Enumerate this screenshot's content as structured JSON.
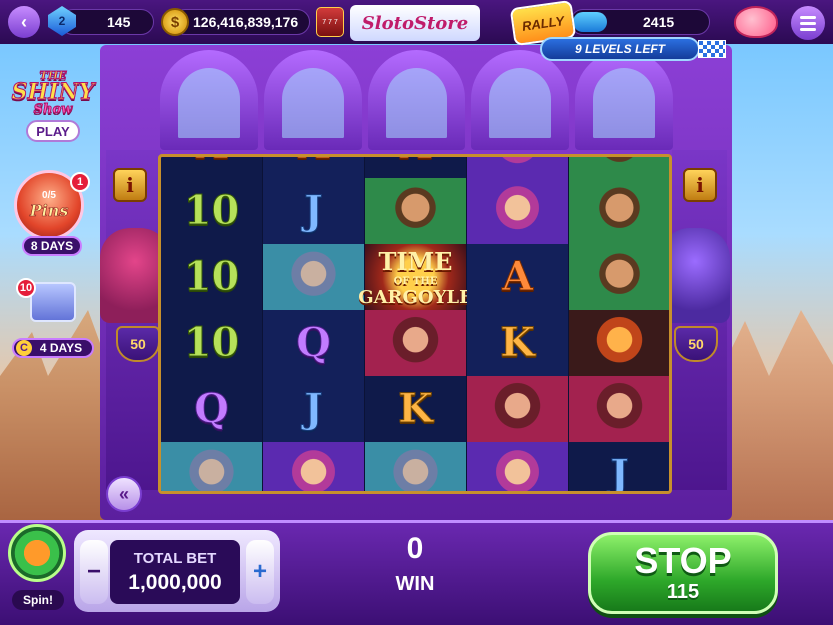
{
  "header": {
    "gems": "145",
    "coins": "126,416,839,176",
    "store_label": "SlotoStore",
    "slot_icon_text": "7 7 7",
    "rally_label": "RALLY",
    "rally_points": "2415",
    "rally_progress": 0.25,
    "levels_left": "9 LEVELS LEFT"
  },
  "side": {
    "shiny_show": {
      "line1": "THE",
      "line2": "SHINY",
      "line3": "Show"
    },
    "play_label": "PLAY",
    "pins_progress": "0/5",
    "pins_label": "Pins",
    "pins_badge": "1",
    "pins_days": "8 DAYS",
    "chest_badge": "10",
    "chest_days": "4 DAYS",
    "c_icon": "C",
    "collapse_icon": "«"
  },
  "machine": {
    "info_left": "i",
    "info_right": "i",
    "shield_left": "50",
    "shield_right": "50",
    "logo": {
      "line1": "TIME",
      "line2": "OF THE",
      "line3": "GARGOYLE"
    },
    "reels": [
      [
        {
          "type": "text",
          "v": "A",
          "c": "ace"
        },
        {
          "type": "text",
          "v": "A",
          "c": "ace"
        },
        {
          "type": "text",
          "v": "A",
          "c": "ace"
        },
        {
          "type": "face",
          "f": "jester"
        },
        {
          "type": "face",
          "f": "man"
        }
      ],
      [
        {
          "type": "text",
          "v": "10",
          "c": "ten"
        },
        {
          "type": "text",
          "v": "J",
          "c": "jack"
        },
        {
          "type": "face",
          "f": "man"
        },
        {
          "type": "face",
          "f": "jester"
        },
        {
          "type": "face",
          "f": "man"
        }
      ],
      [
        {
          "type": "text",
          "v": "10",
          "c": "ten"
        },
        {
          "type": "face",
          "f": "wizard"
        },
        {
          "type": "logo"
        },
        {
          "type": "text",
          "v": "A",
          "c": "ace"
        },
        {
          "type": "face",
          "f": "man"
        }
      ],
      [
        {
          "type": "text",
          "v": "10",
          "c": "ten"
        },
        {
          "type": "text",
          "v": "Q",
          "c": "queen"
        },
        {
          "type": "face",
          "f": "lady"
        },
        {
          "type": "text",
          "v": "K",
          "c": "king"
        },
        {
          "type": "face",
          "f": "demon"
        }
      ],
      [
        {
          "type": "text",
          "v": "Q",
          "c": "queen"
        },
        {
          "type": "text",
          "v": "J",
          "c": "jack"
        },
        {
          "type": "text",
          "v": "K",
          "c": "king"
        },
        {
          "type": "face",
          "f": "lady"
        },
        {
          "type": "face",
          "f": "lady"
        }
      ],
      [
        {
          "type": "face",
          "f": "wizard"
        },
        {
          "type": "face",
          "f": "jester"
        },
        {
          "type": "face",
          "f": "wizard"
        },
        {
          "type": "face",
          "f": "jester"
        },
        {
          "type": "text",
          "v": "J",
          "c": "jack"
        }
      ]
    ]
  },
  "footer": {
    "spin_label": "Spin!",
    "total_bet_label": "TOTAL BET",
    "total_bet_value": "1,000,000",
    "minus": "−",
    "plus": "+",
    "win_value": "0",
    "win_label": "WIN",
    "stop_label": "STOP",
    "stop_count": "115"
  }
}
